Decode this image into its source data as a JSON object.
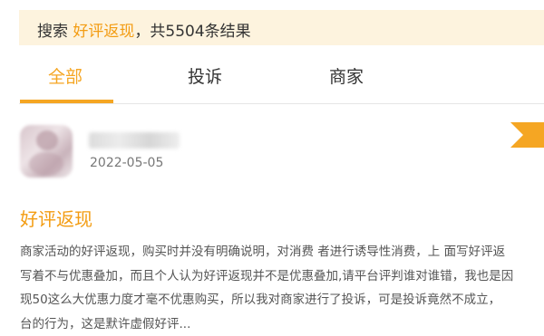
{
  "banner": {
    "prefix": "搜索",
    "keyword": "好评返现",
    "suffix": "，共5504条结果"
  },
  "tabs": [
    {
      "label": "全部",
      "active": true
    },
    {
      "label": "投诉",
      "active": false
    },
    {
      "label": "商家",
      "active": false
    }
  ],
  "post": {
    "date": "2022-05-05",
    "title": "好评返现",
    "lines": [
      "商家活动的好评返现，购买时并没有明确说明，对消费 者进行诱导性消费，上 面写好评返",
      "写着不与优惠叠加，而且个人认为好评返现并不是优惠叠加,请平台评判谁对谁错，我也是因",
      "现50这么大优惠力度才毫不优惠购买，所以我对商家进行了投诉，可是投诉竟然不成立，",
      "台的行为，这是默许虚假好评..."
    ]
  },
  "colors": {
    "accent": "#f5a623",
    "banner_bg": "#fdf3de",
    "text": "#333333"
  }
}
